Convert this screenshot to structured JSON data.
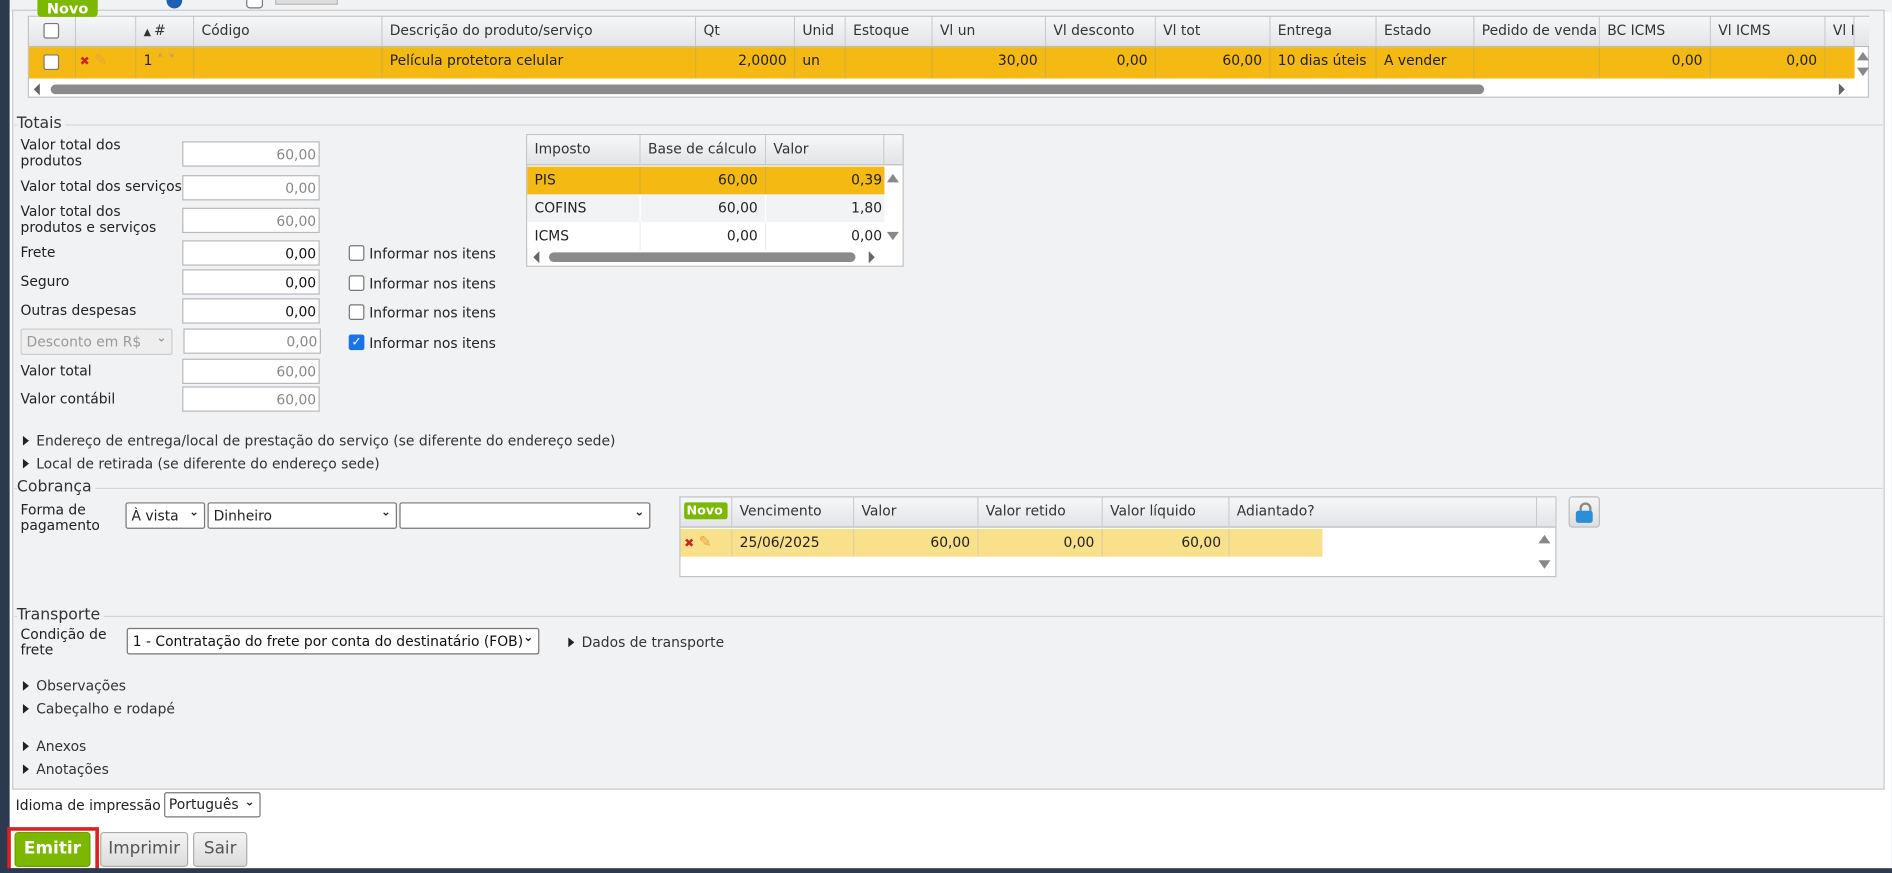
{
  "toolbar": {
    "new_label": "Novo"
  },
  "products": {
    "headers": [
      "#",
      "Código",
      "Descrição do produto/serviço",
      "Qt",
      "Unid",
      "Estoque",
      "Vl un",
      "Vl desconto",
      "Vl tot",
      "Entrega",
      "Estado",
      "Pedido de venda",
      "BC ICMS",
      "Vl ICMS",
      "Vl I"
    ],
    "row": {
      "num": "1",
      "codigo": "",
      "descricao": "Película protetora celular",
      "qt": "2,0000",
      "unid": "un",
      "estoque": "",
      "vl_un": "30,00",
      "vl_desconto": "0,00",
      "vl_tot": "60,00",
      "entrega": "10 dias úteis",
      "estado": "A vender",
      "pedido": "",
      "bc_icms": "0,00",
      "vl_icms": "0,00"
    }
  },
  "totais": {
    "title": "Totais",
    "fields": [
      {
        "label": "Valor total dos produtos",
        "value": "60,00"
      },
      {
        "label": "Valor total dos serviços",
        "value": "0,00"
      },
      {
        "label": "Valor total dos produtos e serviços",
        "value": "60,00"
      },
      {
        "label": "Frete",
        "value": "0,00"
      },
      {
        "label": "Seguro",
        "value": "0,00"
      },
      {
        "label": "Outras despesas",
        "value": "0,00"
      },
      {
        "label": "Desconto em R$",
        "value": "0,00"
      },
      {
        "label": "Valor total",
        "value": "60,00"
      },
      {
        "label": "Valor contábil",
        "value": "60,00"
      }
    ],
    "informar_label": "Informar nos itens",
    "informar_checked": [
      false,
      false,
      false,
      true
    ]
  },
  "impostos": {
    "headers": [
      "Imposto",
      "Base de cálculo",
      "Valor"
    ],
    "rows": [
      [
        "PIS",
        "60,00",
        "0,39"
      ],
      [
        "COFINS",
        "60,00",
        "1,80"
      ],
      [
        "ICMS",
        "0,00",
        "0,00"
      ]
    ]
  },
  "sections": {
    "endereco": "Endereço de entrega/local de prestação do serviço (se diferente do endereço sede)",
    "retirada": "Local de retirada (se diferente do endereço sede)",
    "observacoes": "Observações",
    "cabecalho": "Cabeçalho e rodapé",
    "anexos": "Anexos",
    "anotacoes": "Anotações"
  },
  "cobranca": {
    "title": "Cobrança",
    "forma_label": "Forma de pagamento",
    "condicao": "À vista",
    "meio": "Dinheiro",
    "extra": "",
    "new_label": "Novo",
    "headers": [
      "Vencimento",
      "Valor",
      "Valor retido",
      "Valor líquido",
      "Adiantado?"
    ],
    "row": {
      "vencimento": "25/06/2025",
      "valor": "60,00",
      "retido": "0,00",
      "liquido": "60,00",
      "adiantado": ""
    }
  },
  "transporte": {
    "title": "Transporte",
    "condicao_label": "Condição de frete",
    "condicao": "1 - Contratação do frete por conta do destinatário (FOB)",
    "dados": "Dados de transporte"
  },
  "idioma": {
    "label": "Idioma de impressão",
    "value": "Português"
  },
  "actions": {
    "emitir": "Emitir",
    "imprimir": "Imprimir",
    "sair": "Sair"
  },
  "colors": {
    "selected_row": "#f5b914",
    "accent_green": "#7cb800",
    "highlight": "#e02020"
  }
}
